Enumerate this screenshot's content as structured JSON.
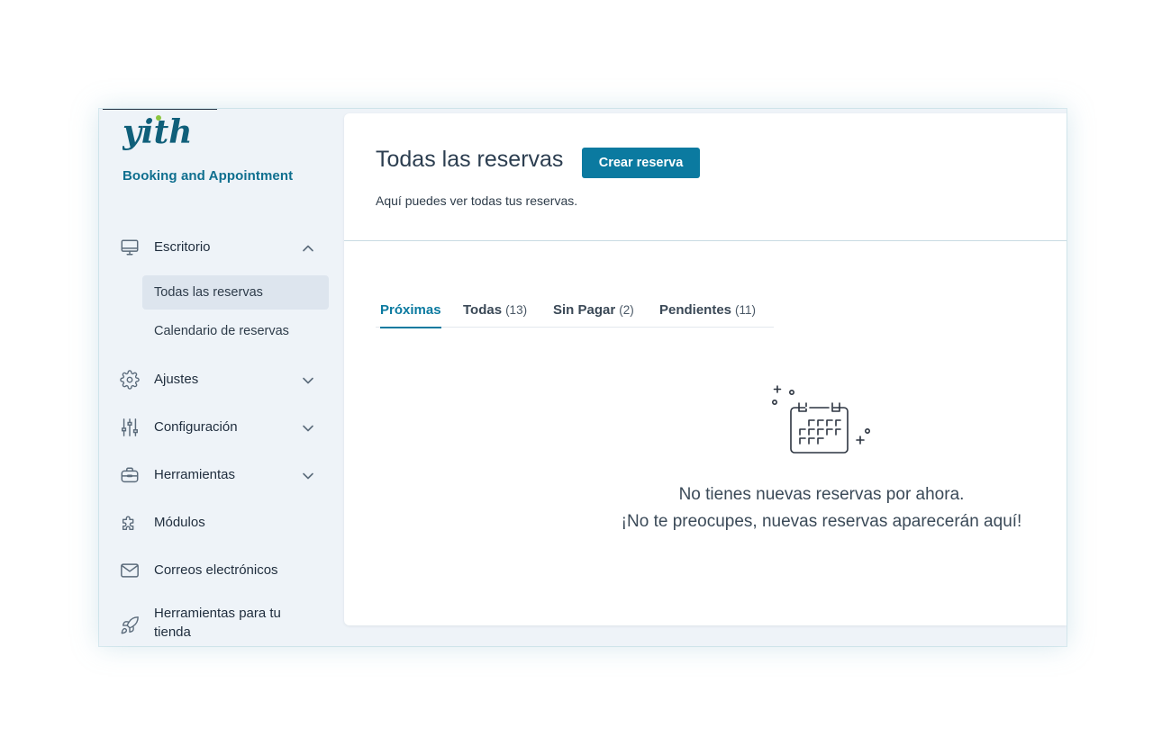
{
  "brand": {
    "logo_text": "yith",
    "product_name": "Booking and Appointment",
    "logo_color": "#0f5f7a",
    "logo_accent": "#8cc63f"
  },
  "sidebar": {
    "items": [
      {
        "label": "Escritorio",
        "icon": "monitor-icon",
        "expanded": true,
        "children": [
          {
            "label": "Todas las reservas",
            "active": true
          },
          {
            "label": "Calendario de reservas",
            "active": false
          }
        ]
      },
      {
        "label": "Ajustes",
        "icon": "gear-icon",
        "expanded": false
      },
      {
        "label": "Configuración",
        "icon": "sliders-icon",
        "expanded": false
      },
      {
        "label": "Herramientas",
        "icon": "toolbox-icon",
        "expanded": false
      },
      {
        "label": "Módulos",
        "icon": "puzzle-icon"
      },
      {
        "label": "Correos electrónicos",
        "icon": "envelope-icon"
      },
      {
        "label": "Herramientas para tu tienda",
        "icon": "rocket-icon"
      }
    ]
  },
  "header": {
    "title": "Todas las reservas",
    "create_button": "Crear reserva",
    "description": "Aquí puedes ver todas tus reservas."
  },
  "tabs": [
    {
      "label": "Próximas",
      "count": "",
      "active": true
    },
    {
      "label": "Todas",
      "count": "(13)",
      "active": false
    },
    {
      "label": "Sin Pagar",
      "count": "(2)",
      "active": false
    },
    {
      "label": "Pendientes",
      "count": "(11)",
      "active": false
    }
  ],
  "empty_state": {
    "icon": "calendar-icon",
    "line1": "No tienes nuevas reservas por ahora.",
    "line2": "¡No te preocupes, nuevas reservas aparecerán aquí!"
  },
  "colors": {
    "accent": "#0b7aa0",
    "sidebar_bg": "#eef3f8",
    "active_item_bg": "#dde5ee"
  }
}
